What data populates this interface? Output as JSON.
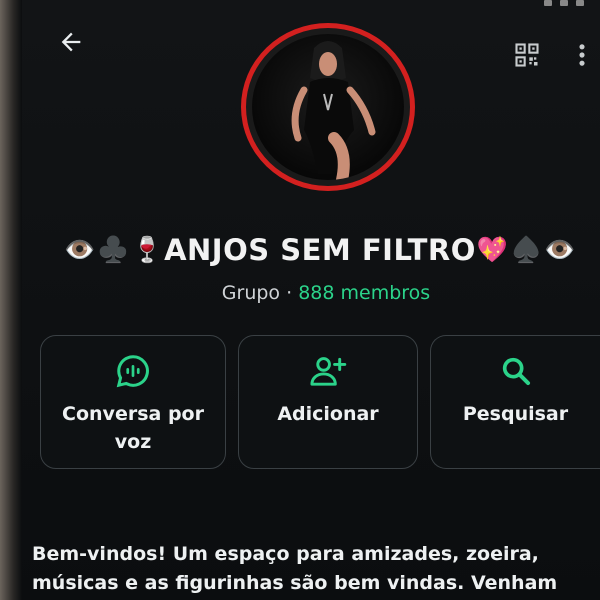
{
  "header": {
    "back_icon": "arrow-left-icon",
    "qr_icon": "qr-code-icon",
    "more_icon": "more-vert-icon"
  },
  "group": {
    "name_prefix_emojis": [
      "👁️",
      "♣️",
      "🍷"
    ],
    "name": "ANJOS SEM FILTRO",
    "name_suffix_emojis": [
      "💖",
      "♠️",
      "👁️"
    ],
    "type_label": "Grupo",
    "separator": "·",
    "members": "888 membros",
    "avatar_ring_color": "#d3201f"
  },
  "actions": [
    {
      "icon": "voice-chat-icon",
      "label": "Conversa por voz"
    },
    {
      "icon": "add-person-icon",
      "label": "Adicionar"
    },
    {
      "icon": "search-icon",
      "label": "Pesquisar"
    }
  ],
  "description": "Bem-vindos! Um espaço para amizades, zoeira, músicas e as figurinhas são bem vindas. Venham",
  "colors": {
    "accent": "#2bd38a",
    "background": "#0b0d0f"
  }
}
